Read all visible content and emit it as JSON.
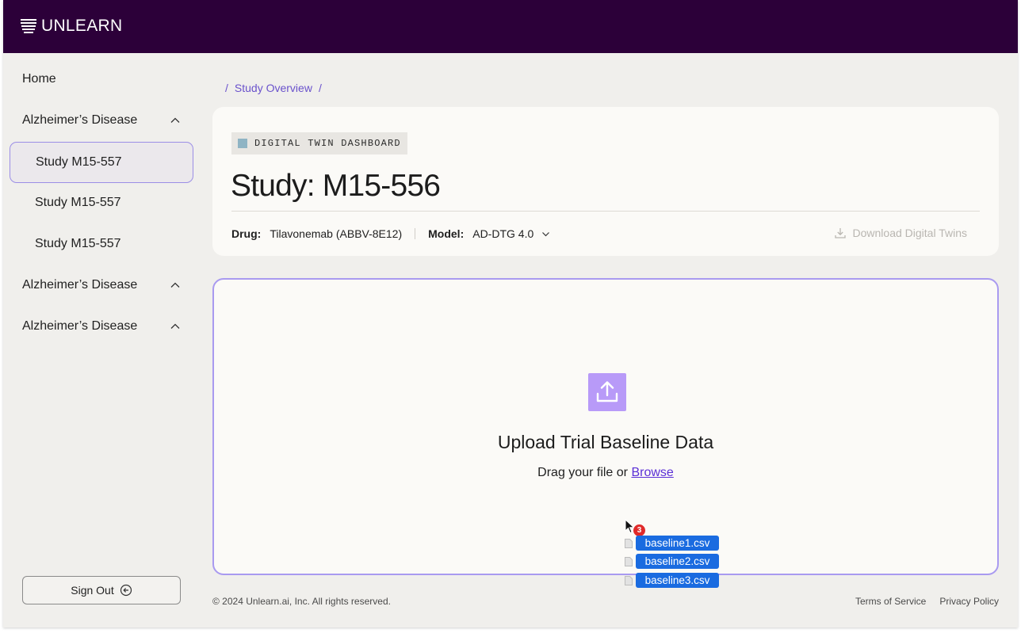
{
  "header": {
    "brand": "UNLEARN"
  },
  "sidebar": {
    "items": [
      {
        "label": "Home"
      },
      {
        "label": "Alzheimer’s Disease",
        "expanded": true
      },
      {
        "label": "Study M15-557",
        "active": true
      },
      {
        "label": "Study M15-557"
      },
      {
        "label": "Study M15-557"
      },
      {
        "label": "Alzheimer’s Disease",
        "expanded": true
      },
      {
        "label": "Alzheimer’s Disease",
        "expanded": true
      }
    ],
    "signout_label": "Sign Out"
  },
  "breadcrumb": {
    "sep": "/",
    "item": "Study Overview"
  },
  "study_card": {
    "badge": "DIGITAL TWIN DASHBOARD",
    "title": "Study: M15-556",
    "drug_label": "Drug:",
    "drug_value": "Tilavonemab (ABBV-8E12)",
    "model_label": "Model:",
    "model_value": "AD-DTG 4.0",
    "download_label": "Download Digital Twins"
  },
  "upload": {
    "title": "Upload Trial Baseline Data",
    "prompt": "Drag your file or",
    "browse": "Browse"
  },
  "drag": {
    "count": "3",
    "files": [
      "baseline1.csv",
      "baseline2.csv",
      "baseline3.csv"
    ]
  },
  "footer": {
    "copyright": "© 2024 Unlearn.ai, Inc. All rights reserved.",
    "terms": "Terms of Service",
    "privacy": "Privacy Policy"
  },
  "colors": {
    "header_bg": "#2c0039",
    "accent": "#6a52cc",
    "upload_icon": "#b89af8",
    "file_chip": "#1a6be0",
    "badge_count": "#e02a2a"
  }
}
